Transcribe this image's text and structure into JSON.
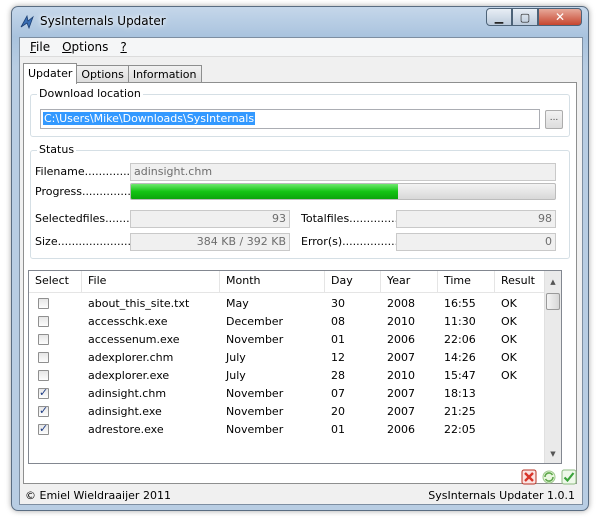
{
  "window": {
    "title": "SysInternals Updater"
  },
  "menu": [
    {
      "key": "F",
      "rest": "ile"
    },
    {
      "key": "O",
      "rest": "ptions"
    },
    {
      "key": "?",
      "rest": ""
    }
  ],
  "tabs": [
    "Updater",
    "Options",
    "Information"
  ],
  "download": {
    "group_label": "Download location",
    "path": "C:\\Users\\Mike\\Downloads\\SysInternals",
    "browse_label": "..."
  },
  "status": {
    "group_label": "Status",
    "filename_label": "Filename....................",
    "filename": "adinsight.chm",
    "progress_label": "Progress...........................",
    "progress_fraction": 0.63,
    "selectedfiles_label": "Selectedfiles.............",
    "selectedfiles": "93",
    "totalfiles_label": "Totalfiles...................",
    "totalfiles": "98",
    "size_label": "Size.............................",
    "size": "384 KB / 392 KB",
    "errors_label": "Error(s)........................",
    "errors": "0"
  },
  "table": {
    "headers": [
      "Select",
      "File",
      "Month",
      "Day",
      "Year",
      "Time",
      "Result"
    ],
    "rows": [
      {
        "checked": false,
        "file": "about_this_site.txt",
        "month": "May",
        "day": "30",
        "year": "2008",
        "time": "16:55",
        "result": "OK"
      },
      {
        "checked": false,
        "file": "accesschk.exe",
        "month": "December",
        "day": "08",
        "year": "2010",
        "time": "11:30",
        "result": "OK"
      },
      {
        "checked": false,
        "file": "accessenum.exe",
        "month": "November",
        "day": "01",
        "year": "2006",
        "time": "22:06",
        "result": "OK"
      },
      {
        "checked": false,
        "file": "adexplorer.chm",
        "month": "July",
        "day": "12",
        "year": "2007",
        "time": "14:26",
        "result": "OK"
      },
      {
        "checked": false,
        "file": "adexplorer.exe",
        "month": "July",
        "day": "28",
        "year": "2010",
        "time": "15:47",
        "result": "OK"
      },
      {
        "checked": true,
        "file": "adinsight.chm",
        "month": "November",
        "day": "07",
        "year": "2007",
        "time": "18:13",
        "result": ""
      },
      {
        "checked": true,
        "file": "adinsight.exe",
        "month": "November",
        "day": "20",
        "year": "2007",
        "time": "21:25",
        "result": ""
      },
      {
        "checked": true,
        "file": "adrestore.exe",
        "month": "November",
        "day": "01",
        "year": "2006",
        "time": "22:05",
        "result": ""
      }
    ]
  },
  "statusbar": {
    "author": "Emiel Wieldraaijer 2011",
    "version": "SysInternals Updater 1.0.1"
  },
  "colors": {
    "progress_fill": "#13c413",
    "selection": "#3399ff",
    "cancel_red": "#d8352a",
    "ok_green": "#3aa33a"
  }
}
